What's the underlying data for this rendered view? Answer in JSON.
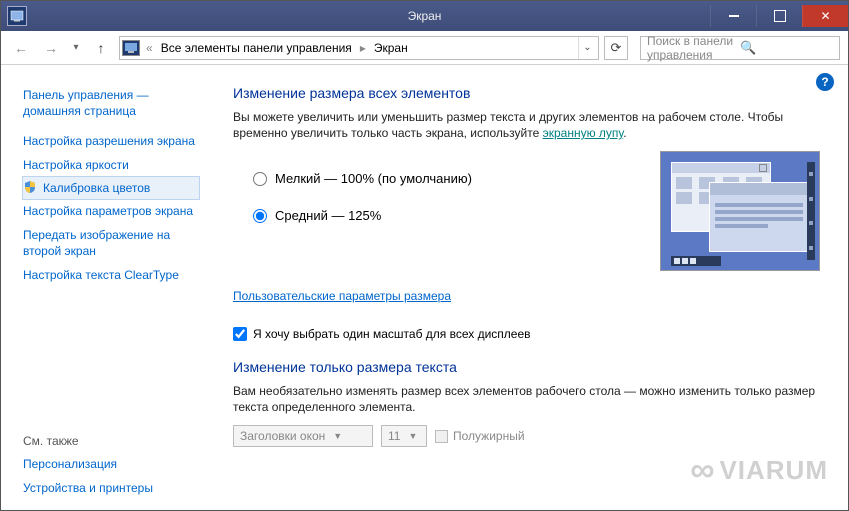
{
  "window": {
    "title": "Экран"
  },
  "breadcrumb": {
    "all_items": "Все элементы панели управления",
    "current": "Экран",
    "back_chevrons": "«"
  },
  "search": {
    "placeholder": "Поиск в панели управления"
  },
  "sidebar": {
    "items": [
      "Панель управления — домашняя страница",
      "Настройка разрешения экрана",
      "Настройка яркости",
      "Калибровка цветов",
      "Настройка параметров экрана",
      "Передать изображение на второй экран",
      "Настройка текста ClearType"
    ],
    "seealso_label": "См. также",
    "seealso": [
      "Персонализация",
      "Устройства и принтеры"
    ]
  },
  "main": {
    "section1_title": "Изменение размера всех элементов",
    "section1_desc_a": "Вы можете увеличить или уменьшить размер текста и других элементов на рабочем столе. Чтобы временно увеличить только часть экрана, используйте ",
    "section1_link": "экранную лупу",
    "radio_small": "Мелкий — 100% (по умолчанию)",
    "radio_medium": "Средний — 125%",
    "custom_link": "Пользовательские параметры размера",
    "checkbox_label": "Я хочу выбрать один масштаб для всех дисплеев",
    "section2_title": "Изменение только размера текста",
    "section2_desc": "Вам необязательно изменять размер всех элементов рабочего стола — можно изменить только размер текста определенного элемента.",
    "combo_element": "Заголовки окон",
    "combo_size": "11",
    "bold_label": "Полужирный"
  },
  "watermark": "VIARUM"
}
